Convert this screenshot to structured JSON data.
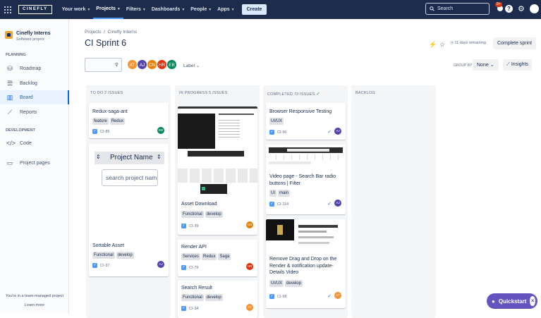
{
  "topbar": {
    "logo": "CINEFLY",
    "nav": [
      {
        "label": "Your work",
        "active": false
      },
      {
        "label": "Projects",
        "active": true
      },
      {
        "label": "Filters",
        "active": false
      },
      {
        "label": "Dashboards",
        "active": false
      },
      {
        "label": "People",
        "active": false
      },
      {
        "label": "Apps",
        "active": false
      }
    ],
    "create_label": "Create",
    "search_placeholder": "Search",
    "notification_count": "9+"
  },
  "sidebar": {
    "project_name": "Cinefly Interns",
    "project_type": "Software project",
    "planning_label": "PLANNING",
    "planning_items": [
      {
        "label": "Roadmap",
        "icon": "roadmap-icon"
      },
      {
        "label": "Backlog",
        "icon": "backlog-icon"
      },
      {
        "label": "Board",
        "icon": "board-icon",
        "active": true
      }
    ],
    "reports_label": "Reports",
    "development_label": "DEVELOPMENT",
    "code_label": "Code",
    "project_pages_label": "Project pages",
    "team_text": "You're in a team-managed project",
    "learn_more": "Learn more"
  },
  "header": {
    "breadcrumb_projects": "Projects",
    "breadcrumb_sep": "/",
    "breadcrumb_project": "Cinefly Interns",
    "title": "CI Sprint 6",
    "days_remaining": "11 days remaining",
    "complete_sprint": "Complete sprint"
  },
  "filters": {
    "avatars": [
      {
        "initials": "AT",
        "color": "#f79232"
      },
      {
        "initials": "AJ",
        "color": "#5243aa"
      },
      {
        "initials": "CN",
        "color": "#e6820a"
      },
      {
        "initials": "HR",
        "color": "#de350b"
      },
      {
        "initials": "EB",
        "color": "#00875a"
      }
    ],
    "label_dropdown": "Label",
    "group_by_label": "GROUP BY",
    "group_by_value": "None",
    "insights_label": "Insights"
  },
  "board": {
    "columns": [
      {
        "title": "TO DO 2 ISSUES"
      },
      {
        "title": "IN PROGRESS 5 ISSUES"
      },
      {
        "title": "COMPLETED 73 ISSUES"
      },
      {
        "title": "BACKLOG"
      }
    ],
    "cards": {
      "todo1": {
        "title": "Redux-saga-ant",
        "tags": [
          "feature",
          "Redux"
        ],
        "key": "CI-85",
        "assignee": "EB",
        "color": "#00875a"
      },
      "todo2": {
        "title": "Sortable Asset",
        "tags": [
          "Functional",
          "develop"
        ],
        "key": "CI-37",
        "assignee": "AJ",
        "color": "#5243aa",
        "thumb_heading": "Project Name",
        "thumb_input": "search project nam"
      },
      "prog1": {
        "title": "Asset Download",
        "tags": [
          "Functional",
          "develop"
        ],
        "key": "CI-39",
        "assignee": "CN",
        "color": "#e6820a"
      },
      "prog2": {
        "title": "Render API",
        "tags": [
          "Services",
          "Redux",
          "Saga"
        ],
        "key": "CI-79",
        "assignee": "HR",
        "color": "#de350b"
      },
      "prog3": {
        "title": "Search Result",
        "tags": [
          "Functional",
          "develop"
        ],
        "key": "CI-34",
        "assignee": "AT",
        "color": "#f79232"
      },
      "done1": {
        "title": "Browser Responsive Testing",
        "tags": [
          "UI/UX"
        ],
        "key": "CI-96",
        "assignee": "AJ",
        "color": "#5243aa"
      },
      "done2": {
        "title": "Video page - Search Bar radio buttons | Filter",
        "tags": [
          "UI",
          "main"
        ],
        "key": "CI-114",
        "assignee": "AJ",
        "color": "#5243aa"
      },
      "done3": {
        "title": "Remove Drag and Drop on the Render & notification update- Details Video",
        "tags": [
          "UI/UX",
          "develop"
        ],
        "key": "CI-98",
        "assignee": "AT",
        "color": "#f79232"
      }
    }
  },
  "quickstart": {
    "label": "Quickstart"
  }
}
